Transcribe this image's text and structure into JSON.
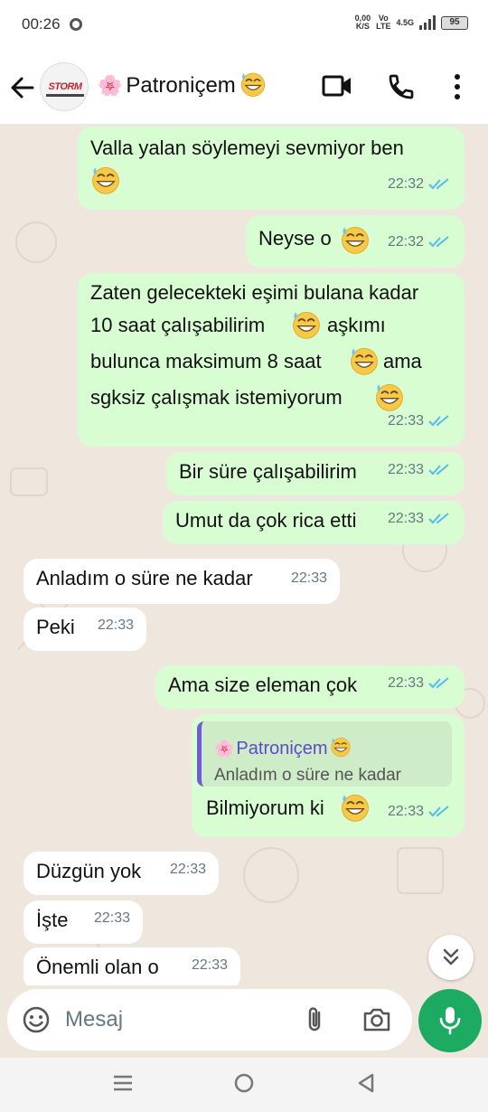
{
  "status_bar": {
    "time": "00:26",
    "speed_value": "0,00",
    "speed_unit": "K/S",
    "network_top": "Vo",
    "network_bottom": "LTE",
    "signal_type": "4.5G",
    "battery": "95"
  },
  "header": {
    "avatar_logo": "STORM",
    "contact_flower": "🌸",
    "contact_name": "Patroniçem",
    "icons": [
      "back-arrow-icon",
      "video-call-icon",
      "phone-icon",
      "more-vert-icon"
    ]
  },
  "messages": [
    {
      "dir": "out",
      "lines": [
        "Valla yalan söylemeyi sevmiyor ben"
      ],
      "time": "22:32",
      "status": "read"
    },
    {
      "dir": "out",
      "text": "Neyse o",
      "time": "22:32",
      "status": "read"
    },
    {
      "dir": "out",
      "lines": [
        "Zaten gelecekteki eşimi bulana kadar",
        "10 saat çalışabilirim",
        "aşkımı",
        "bulunca maksimum 8 saat",
        "ama",
        "sgksiz çalışmak istemiyorum"
      ],
      "time": "22:33",
      "status": "read"
    },
    {
      "dir": "out",
      "text": "Bir süre çalışabilirim",
      "time": "22:33",
      "status": "read"
    },
    {
      "dir": "out",
      "text": "Umut da çok rica etti",
      "time": "22:33",
      "status": "read"
    },
    {
      "dir": "in",
      "text": "Anladım o süre ne kadar",
      "time": "22:33"
    },
    {
      "dir": "in",
      "text": "Peki",
      "time": "22:33"
    },
    {
      "dir": "out",
      "text": "Ama size eleman çok",
      "time": "22:33",
      "status": "read"
    },
    {
      "dir": "out",
      "quote_name": "Patroniçem",
      "quote_text": "Anladım o süre ne kadar",
      "text": "Bilmiyorum ki",
      "time": "22:33",
      "status": "read"
    },
    {
      "dir": "in",
      "text": "Düzgün yok",
      "time": "22:33"
    },
    {
      "dir": "in",
      "text": "İşte",
      "time": "22:33"
    },
    {
      "dir": "in",
      "text": "Önemli olan o",
      "time": "22:33"
    }
  ],
  "composer": {
    "placeholder": "Mesaj",
    "icons": [
      "emoji-icon",
      "attach-icon",
      "camera-icon",
      "mic-icon"
    ]
  },
  "colors": {
    "outgoing_bubble": "#d9fdd3",
    "incoming_bubble": "#ffffff",
    "chat_background": "#efe7dd",
    "read_ticks": "#53bdeb",
    "mic_button": "#1daa61",
    "quote_accent": "#6f5bd6"
  }
}
